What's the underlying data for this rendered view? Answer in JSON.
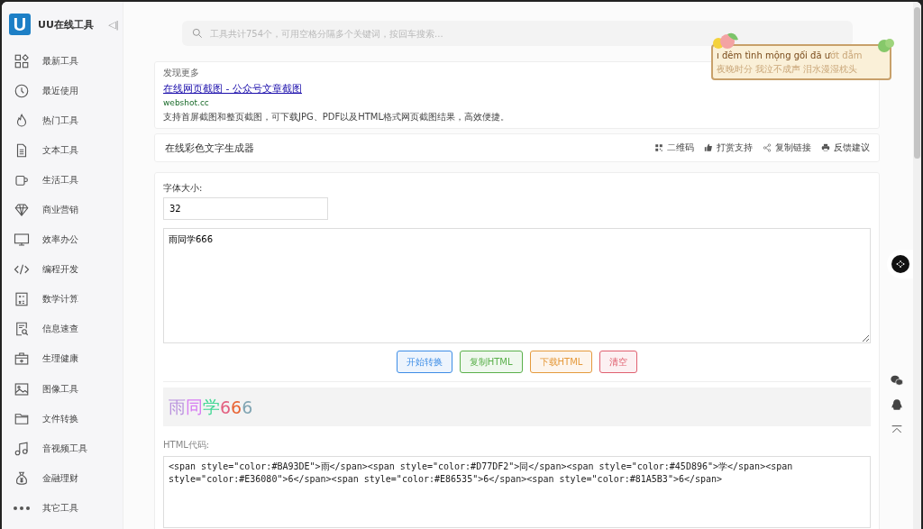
{
  "sidebar": {
    "logo_letter": "U",
    "title": "UU在线工具",
    "collapse_icon": "◁|",
    "items": [
      {
        "label": "最新工具"
      },
      {
        "label": "最近使用"
      },
      {
        "label": "热门工具"
      },
      {
        "label": "文本工具"
      },
      {
        "label": "生活工具"
      },
      {
        "label": "商业营销"
      },
      {
        "label": "效率办公"
      },
      {
        "label": "编程开发"
      },
      {
        "label": "数学计算"
      },
      {
        "label": "信息速查"
      },
      {
        "label": "生理健康"
      },
      {
        "label": "图像工具"
      },
      {
        "label": "文件转换"
      },
      {
        "label": "音视频工具"
      },
      {
        "label": "金融理财"
      },
      {
        "label": "其它工具"
      }
    ]
  },
  "search": {
    "placeholder": "工具共计754个，可用空格分隔多个关键词，按回车搜索..."
  },
  "lyric": {
    "line_1": "ı đêm tình mộng gối đã ư",
    "line_1_rest": "ớt đẫm",
    "line_2": "夜晚时分 我泣不成声 泪水漫湿枕头"
  },
  "ad": {
    "tag": "发现更多",
    "title": "在线网页截图 - 公众号文章截图",
    "domain": "webshot.cc",
    "description": "支持首屏截图和整页截图，可下载JPG、PDF以及HTML格式网页截图结果，高效便捷。"
  },
  "tool": {
    "title": "在线彩色文字生成器",
    "actions": [
      {
        "label": "二维码"
      },
      {
        "label": "打赏支持"
      },
      {
        "label": "复制链接"
      },
      {
        "label": "反馈建议"
      }
    ]
  },
  "form": {
    "font_size_label": "字体大小:",
    "font_size": "32",
    "text": "雨同学666",
    "buttons": [
      {
        "label": "开始转换",
        "color": "#3d8de6"
      },
      {
        "label": "复制HTML",
        "color": "#5ab04a"
      },
      {
        "label": "下载HTML",
        "color": "#e59a3c"
      },
      {
        "label": "清空",
        "color": "#e06070"
      }
    ],
    "preview": [
      {
        "text": "雨",
        "color": "#ba93de"
      },
      {
        "text": "同",
        "color": "#d77df2"
      },
      {
        "text": "学",
        "color": "#45d896"
      },
      {
        "text": "6",
        "color": "#e36080"
      },
      {
        "text": "6",
        "color": "#e86535"
      },
      {
        "text": "6",
        "color": "#81a5b3"
      }
    ],
    "code_label": "HTML代码:",
    "code": "<span style=\"color:#BA93DE\">雨</span><span style=\"color:#D77DF2\">同</span><span style=\"color:#45D896\">学</span><span style=\"color:#E36080\">6</span><span style=\"color:#E86535\">6</span><span style=\"color:#81A5B3\">6</span>"
  }
}
